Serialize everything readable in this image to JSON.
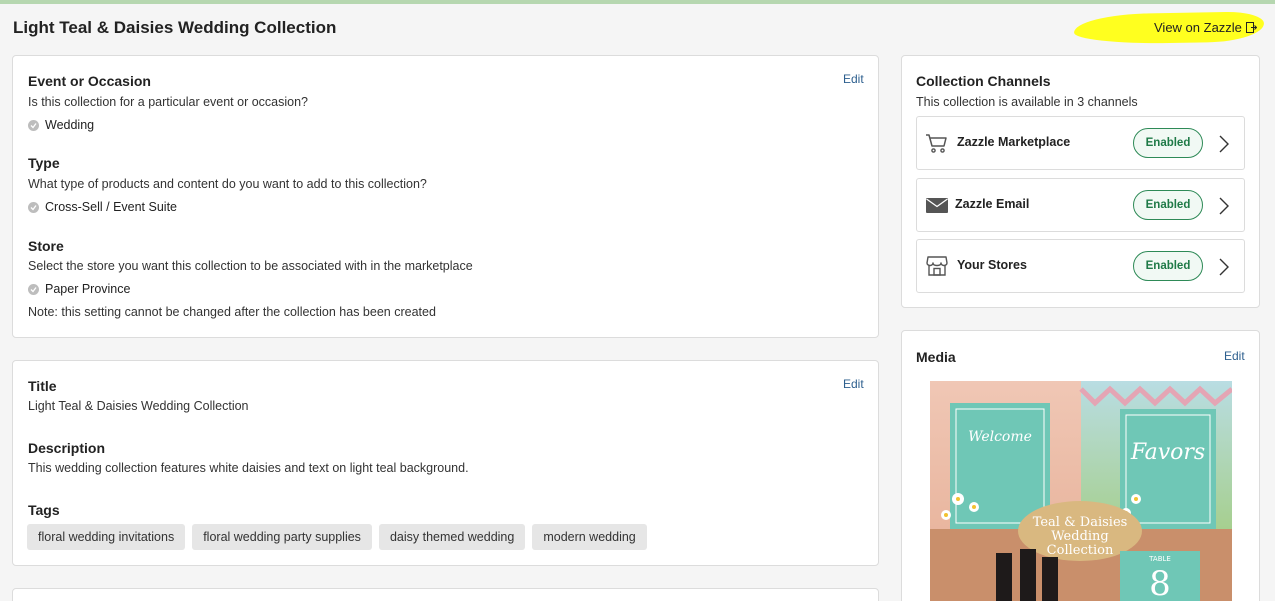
{
  "page": {
    "title": "Light Teal & Daisies Wedding Collection",
    "view_link": "View on Zazzle"
  },
  "occasion_card": {
    "edit": "Edit",
    "event": {
      "title": "Event or Occasion",
      "question": "Is this collection for a particular event or occasion?",
      "value": "Wedding"
    },
    "type": {
      "title": "Type",
      "question": "What type of products and content do you want to add to this collection?",
      "value": "Cross-Sell / Event Suite"
    },
    "store": {
      "title": "Store",
      "question": "Select the store you want this collection to be associated with in the marketplace",
      "value": "Paper Province",
      "note": "Note: this setting cannot be changed after the collection has been created"
    }
  },
  "details_card": {
    "edit": "Edit",
    "title_label": "Title",
    "title_value": "Light Teal & Daisies Wedding Collection",
    "description_label": "Description",
    "description_value": "This wedding collection features white daisies and text on light teal background.",
    "tags_label": "Tags",
    "tags": [
      "floral wedding invitations",
      "floral wedding party supplies",
      "daisy themed wedding",
      "modern wedding"
    ]
  },
  "channels_card": {
    "title": "Collection Channels",
    "subtitle": "This collection is available in 3 channels",
    "channels": [
      {
        "name": "Zazzle Marketplace",
        "status": "Enabled",
        "icon": "cart-icon"
      },
      {
        "name": "Zazzle Email",
        "status": "Enabled",
        "icon": "envelope-icon"
      },
      {
        "name": "Your Stores",
        "status": "Enabled",
        "icon": "storefront-icon"
      }
    ]
  },
  "media_card": {
    "title": "Media",
    "edit": "Edit",
    "image_caption_lines": [
      "Teal & Daisies",
      "Wedding",
      "Collection"
    ],
    "sign_text_1": "Welcome",
    "sign_text_2": "Favors",
    "table_label": "TABLE",
    "table_number": "8"
  },
  "colors": {
    "accent_link": "#2d5f8e",
    "enabled_green": "#1f7a47",
    "teal": "#6fc7b6",
    "highlight": "#ffff1f"
  }
}
